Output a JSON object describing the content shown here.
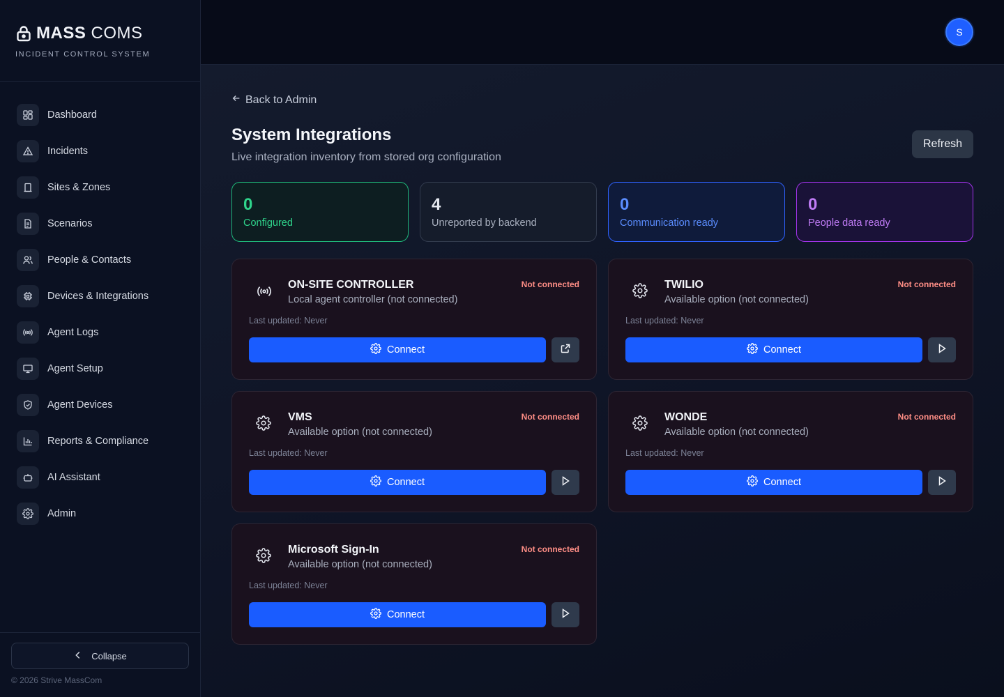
{
  "brand": {
    "name_bold": "MASS",
    "name_light": "COMS",
    "subtitle": "INCIDENT CONTROL SYSTEM"
  },
  "sidebar": {
    "items": [
      {
        "label": "Dashboard",
        "icon": "dashboard-icon"
      },
      {
        "label": "Incidents",
        "icon": "warning-icon"
      },
      {
        "label": "Sites & Zones",
        "icon": "building-icon"
      },
      {
        "label": "Scenarios",
        "icon": "document-icon"
      },
      {
        "label": "People & Contacts",
        "icon": "users-icon"
      },
      {
        "label": "Devices & Integrations",
        "icon": "chip-icon"
      },
      {
        "label": "Agent Logs",
        "icon": "broadcast-icon"
      },
      {
        "label": "Agent Setup",
        "icon": "monitor-icon"
      },
      {
        "label": "Agent Devices",
        "icon": "shield-icon"
      },
      {
        "label": "Reports & Compliance",
        "icon": "bar-chart-icon"
      },
      {
        "label": "AI Assistant",
        "icon": "bot-icon"
      },
      {
        "label": "Admin",
        "icon": "gear-icon"
      }
    ],
    "collapse_label": "Collapse",
    "copyright": "© 2026 Strive MassCom"
  },
  "topbar": {
    "avatar_initial": "S"
  },
  "main": {
    "back_label": "Back to Admin",
    "title": "System Integrations",
    "subtitle": "Live integration inventory from stored org configuration",
    "refresh_label": "Refresh"
  },
  "stats": [
    {
      "value": "0",
      "label": "Configured",
      "color": "#2fd58c"
    },
    {
      "value": "4",
      "label": "Unreported by backend",
      "color": "#a7aebd"
    },
    {
      "value": "0",
      "label": "Communication ready",
      "color": "#5b8dff"
    },
    {
      "value": "0",
      "label": "People data ready",
      "color": "#c07cf6"
    }
  ],
  "integrations": [
    {
      "title": "ON-SITE CONTROLLER",
      "desc": "Local agent controller (not connected)",
      "status": "Not connected",
      "updated": "Last updated: Never",
      "connect_label": "Connect",
      "icon": "broadcast-icon",
      "side_icon": "external-link-icon"
    },
    {
      "title": "TWILIO",
      "desc": "Available option (not connected)",
      "status": "Not connected",
      "updated": "Last updated: Never",
      "connect_label": "Connect",
      "icon": "gear-icon",
      "side_icon": "play-icon"
    },
    {
      "title": "VMS",
      "desc": "Available option (not connected)",
      "status": "Not connected",
      "updated": "Last updated: Never",
      "connect_label": "Connect",
      "icon": "gear-icon",
      "side_icon": "play-icon"
    },
    {
      "title": "WONDE",
      "desc": "Available option (not connected)",
      "status": "Not connected",
      "updated": "Last updated: Never",
      "connect_label": "Connect",
      "icon": "gear-icon",
      "side_icon": "play-icon"
    },
    {
      "title": "Microsoft Sign-In",
      "desc": "Available option (not connected)",
      "status": "Not connected",
      "updated": "Last updated: Never",
      "connect_label": "Connect",
      "icon": "gear-icon",
      "side_icon": "play-icon"
    }
  ],
  "colors": {
    "accent": "#1a5cff",
    "status_error": "#ff8e86",
    "background": "#0b1020"
  }
}
